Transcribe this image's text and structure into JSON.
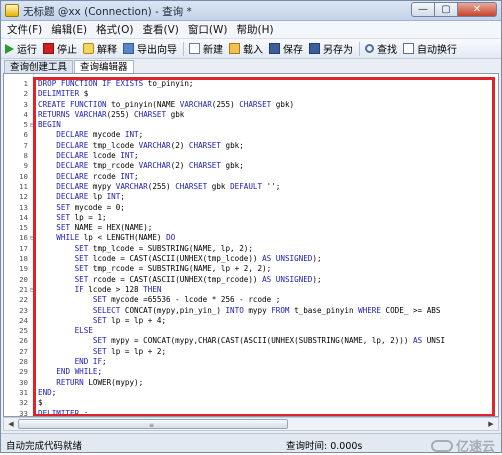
{
  "window": {
    "title": "无标题 @xx (Connection) - 查询 *",
    "buttons": {
      "minimize": "—",
      "maximize": "▢",
      "close": "✕"
    }
  },
  "menu": [
    "文件(F)",
    "编辑(E)",
    "格式(O)",
    "查看(V)",
    "窗口(W)",
    "帮助(H)"
  ],
  "toolbar": {
    "run": "运行",
    "stop": "停止",
    "explain": "解释",
    "export_wizard": "导出向导",
    "new": "新建",
    "load": "载入",
    "save": "保存",
    "save_as": "另存为",
    "find": "查找",
    "word_wrap": "自动换行"
  },
  "tabs": [
    "查询创建工具",
    "查询编辑器"
  ],
  "active_tab": "查询编辑器",
  "code_lines": [
    "DROP FUNCTION IF EXISTS to_pinyin;",
    "DELIMITER $",
    "CREATE FUNCTION to_pinyin(NAME VARCHAR(255) CHARSET gbk)",
    "RETURNS VARCHAR(255) CHARSET gbk",
    "BEGIN",
    "    DECLARE mycode INT;",
    "    DECLARE tmp_lcode VARCHAR(2) CHARSET gbk;",
    "    DECLARE lcode INT;",
    "    DECLARE tmp_rcode VARCHAR(2) CHARSET gbk;",
    "    DECLARE rcode INT;",
    "    DECLARE mypy VARCHAR(255) CHARSET gbk DEFAULT '';",
    "    DECLARE lp INT;",
    "    SET mycode = 0;",
    "    SET lp = 1;",
    "    SET NAME = HEX(NAME);",
    "    WHILE lp < LENGTH(NAME) DO",
    "        SET tmp_lcode = SUBSTRING(NAME, lp, 2);",
    "        SET lcode = CAST(ASCII(UNHEX(tmp_lcode)) AS UNSIGNED);",
    "        SET tmp_rcode = SUBSTRING(NAME, lp + 2, 2);",
    "        SET rcode = CAST(ASCII(UNHEX(tmp_rcode)) AS UNSIGNED);",
    "        IF lcode > 128 THEN",
    "            SET mycode =65536 - lcode * 256 - rcode ;",
    "            SELECT CONCAT(mypy,pin_yin_) INTO mypy FROM t_base_pinyin WHERE CODE_ >= ABS",
    "            SET lp = lp + 4;",
    "        ELSE",
    "            SET mypy = CONCAT(mypy,CHAR(CAST(ASCII(UNHEX(SUBSTRING(NAME, lp, 2))) AS UNSI",
    "            SET lp = lp + 2;",
    "        END IF;",
    "    END WHILE;",
    "    RETURN LOWER(mypy);",
    "END;",
    "$",
    "DELIMITER ;"
  ],
  "fold_markers": {
    "5": "⊟",
    "16": "⊟",
    "21": "⊟"
  },
  "status": {
    "left": "自动完成代码就绪",
    "query_time": "查询时间: 0.000s"
  },
  "watermark": "亿速云",
  "colors": {
    "highlight": "#e0232a",
    "keyword": "#1c1cb4"
  }
}
